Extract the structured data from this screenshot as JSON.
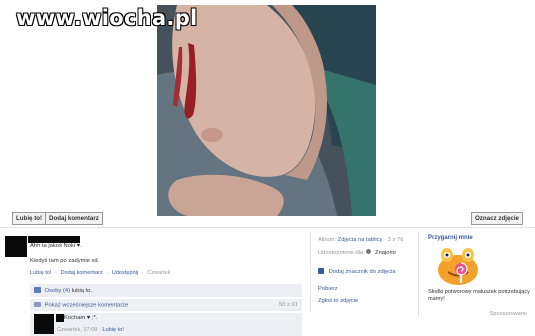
{
  "watermark": "www.wiocha.pl",
  "photo_actions": {
    "like_label": "Lubię to!",
    "comment_label": "Dodaj komentarz",
    "tag_label": "Oznacz zdjęcie"
  },
  "post": {
    "caption": "Ahh ta jakoś Noki ♥.",
    "subtitle": "Kiedyś tam po zadymie xd.",
    "actions": [
      "Lubię to!",
      "·",
      "Dodaj komentarz",
      "·",
      "Udostępnij",
      "·",
      "Czwartek"
    ]
  },
  "likes": {
    "text": "Osoby (4)",
    "suffix": "lubią to."
  },
  "older_comments": {
    "label": "Pokaż wcześniejsze komentarze",
    "count": "50 z 91"
  },
  "comment": {
    "text": "Kocham ♥ ;*.",
    "time": "Czwartek, 17:09",
    "separator": "·",
    "like": "Lubię to!"
  },
  "photo_meta": {
    "album_label": "Album:",
    "album_name": "Zdjęcia na tablicy",
    "album_position": "· 3 z 76",
    "shared_label": "Udostępnione dla:",
    "shared_value": "Znajomi",
    "add_location": "Dodaj znacznik do zdjęcia",
    "download": "Pobierz",
    "report": "Zgłoś to zdjęcie"
  },
  "ad": {
    "title": "Przygarnij mnie",
    "text": "Słodki potworowy maluszek potrzebujący mamy!",
    "sponsored": "Sponsorowane"
  },
  "colors": {
    "link": "#3b5998",
    "panel": "#edeff4",
    "muted": "#999999"
  }
}
